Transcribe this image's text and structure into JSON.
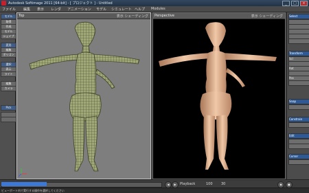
{
  "window": {
    "title": "Autodesk Softimage 2011 [64-bit] - [ プロジェクト ] - Untitled",
    "minimize": "_",
    "maximize": "□",
    "close": "×"
  },
  "menu": [
    "ファイル",
    "編集",
    "表示",
    "レンダ",
    "アニメーション",
    "モデル",
    "シミュレート",
    "ヘルプ",
    "Modules"
  ],
  "left_panel": {
    "items": [
      "モデル",
      "取得",
      "作成",
      "モデル",
      "シェイプ",
      "変形",
      "編集",
      "ポリゴン",
      "選択",
      "表示",
      "ライト",
      "編集",
      "カメラ",
      "Pick"
    ]
  },
  "viewport_left": {
    "label": "Top",
    "menu": "表示  シェーディング"
  },
  "viewport_right": {
    "label": "Perspective",
    "menu": "表示  シェーディング"
  },
  "right_panel": {
    "items": [
      "Select",
      "Transform",
      "Scl",
      "Rot",
      "Pos",
      "Snap",
      "Constrain",
      "Edit",
      "Cursor"
    ]
  },
  "timeline": {
    "frame": "100",
    "playback": "Playback",
    "fps": "30"
  },
  "status": {
    "message": "ビューポート内で実行する操作を選択してください"
  },
  "colors": {
    "accent": "#3b78d8",
    "skin": "#e6b694",
    "wire": "#9aa37a"
  }
}
